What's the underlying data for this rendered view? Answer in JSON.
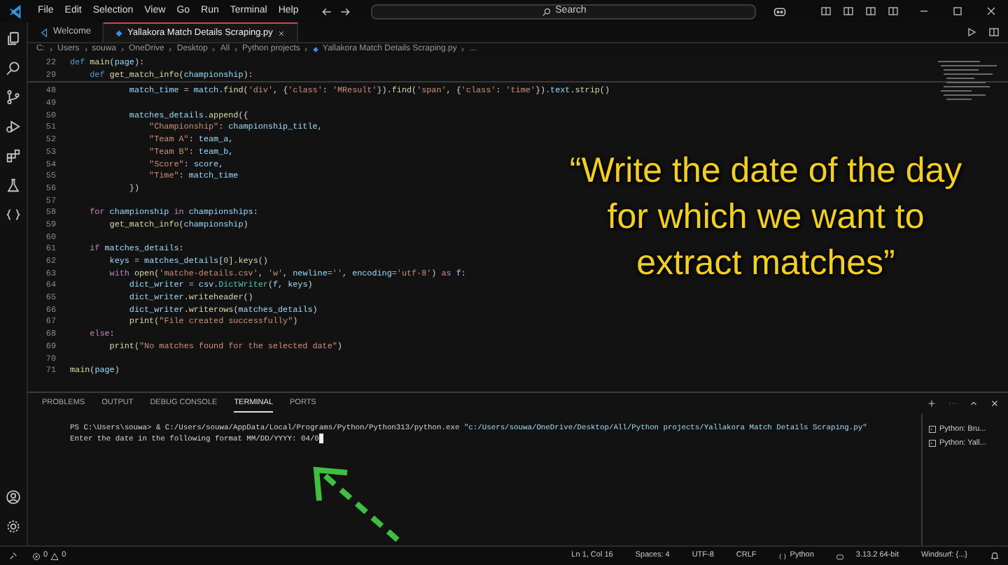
{
  "menu": [
    "File",
    "Edit",
    "Selection",
    "View",
    "Go",
    "Run",
    "Terminal",
    "Help"
  ],
  "search": {
    "placeholder": "Search"
  },
  "tabs": [
    {
      "label": "Welcome",
      "kind": "welcome",
      "selected": false
    },
    {
      "label": "Yallakora Match Details Scraping.py",
      "kind": "python",
      "selected": true
    }
  ],
  "breadcrumb": [
    "C:",
    "Users",
    "souwa",
    "OneDrive",
    "Desktop",
    "All",
    "Python projects",
    "Yallakora Match Details Scraping.py",
    "..."
  ],
  "sticky_lines": [
    {
      "number": "22",
      "tokens": [
        {
          "text": "def ",
          "kind": "kw"
        },
        {
          "text": "main",
          "kind": "fn"
        },
        {
          "text": "(",
          "kind": "p"
        },
        {
          "text": "page",
          "kind": "var"
        },
        {
          "text": "):",
          "kind": "p"
        }
      ]
    },
    {
      "number": "29",
      "tokens": [
        {
          "text": "    def ",
          "kind": "kw"
        },
        {
          "text": "get_match_info",
          "kind": "fn"
        },
        {
          "text": "(",
          "kind": "p"
        },
        {
          "text": "championship",
          "kind": "var"
        },
        {
          "text": "):",
          "kind": "p"
        }
      ]
    }
  ],
  "code_lines": [
    {
      "number": "48",
      "tokens": [
        {
          "text": "            match_time",
          "kind": "var"
        },
        {
          "text": " = ",
          "kind": "p"
        },
        {
          "text": "match",
          "kind": "var"
        },
        {
          "text": ".",
          "kind": "p"
        },
        {
          "text": "find",
          "kind": "fn"
        },
        {
          "text": "(",
          "kind": "p"
        },
        {
          "text": "'div'",
          "kind": "str"
        },
        {
          "text": ", {",
          "kind": "p"
        },
        {
          "text": "'class'",
          "kind": "str"
        },
        {
          "text": ": ",
          "kind": "p"
        },
        {
          "text": "'MResult'",
          "kind": "str"
        },
        {
          "text": "}).",
          "kind": "p"
        },
        {
          "text": "find",
          "kind": "fn"
        },
        {
          "text": "(",
          "kind": "p"
        },
        {
          "text": "'span'",
          "kind": "str"
        },
        {
          "text": ", {",
          "kind": "p"
        },
        {
          "text": "'class'",
          "kind": "str"
        },
        {
          "text": ": ",
          "kind": "p"
        },
        {
          "text": "'time'",
          "kind": "str"
        },
        {
          "text": "}).",
          "kind": "p"
        },
        {
          "text": "text",
          "kind": "var"
        },
        {
          "text": ".",
          "kind": "p"
        },
        {
          "text": "strip",
          "kind": "fn"
        },
        {
          "text": "()",
          "kind": "p"
        }
      ]
    },
    {
      "number": "49"
    },
    {
      "number": "50",
      "tokens": [
        {
          "text": "            matches_details",
          "kind": "var"
        },
        {
          "text": ".",
          "kind": "p"
        },
        {
          "text": "append",
          "kind": "fn"
        },
        {
          "text": "({",
          "kind": "p"
        }
      ]
    },
    {
      "number": "51",
      "tokens": [
        {
          "text": "                \"Championship\"",
          "kind": "str"
        },
        {
          "text": ": ",
          "kind": "p"
        },
        {
          "text": "championship_title",
          "kind": "var"
        },
        {
          "text": ",",
          "kind": "p"
        }
      ]
    },
    {
      "number": "52",
      "tokens": [
        {
          "text": "                \"Team A\"",
          "kind": "str"
        },
        {
          "text": ": ",
          "kind": "p"
        },
        {
          "text": "team_a",
          "kind": "var"
        },
        {
          "text": ",",
          "kind": "p"
        }
      ]
    },
    {
      "number": "53",
      "tokens": [
        {
          "text": "                \"Team B\"",
          "kind": "str"
        },
        {
          "text": ": ",
          "kind": "p"
        },
        {
          "text": "team_b",
          "kind": "var"
        },
        {
          "text": ",",
          "kind": "p"
        }
      ]
    },
    {
      "number": "54",
      "tokens": [
        {
          "text": "                \"Score\"",
          "kind": "str"
        },
        {
          "text": ": ",
          "kind": "p"
        },
        {
          "text": "score",
          "kind": "var"
        },
        {
          "text": ",",
          "kind": "p"
        }
      ]
    },
    {
      "number": "55",
      "tokens": [
        {
          "text": "                \"Time\"",
          "kind": "str"
        },
        {
          "text": ": ",
          "kind": "p"
        },
        {
          "text": "match_time",
          "kind": "var"
        }
      ]
    },
    {
      "number": "56",
      "tokens": [
        {
          "text": "            })",
          "kind": "p"
        }
      ]
    },
    {
      "number": "57"
    },
    {
      "number": "58",
      "tokens": [
        {
          "text": "    for ",
          "kind": "ctl"
        },
        {
          "text": "championship",
          "kind": "var"
        },
        {
          "text": " in ",
          "kind": "ctl"
        },
        {
          "text": "championships",
          "kind": "var"
        },
        {
          "text": ":",
          "kind": "p"
        }
      ]
    },
    {
      "number": "59",
      "tokens": [
        {
          "text": "        get_match_info",
          "kind": "fn"
        },
        {
          "text": "(",
          "kind": "p"
        },
        {
          "text": "championship",
          "kind": "var"
        },
        {
          "text": ")",
          "kind": "p"
        }
      ]
    },
    {
      "number": "60"
    },
    {
      "number": "61",
      "tokens": [
        {
          "text": "    if ",
          "kind": "ctl"
        },
        {
          "text": "matches_details",
          "kind": "var"
        },
        {
          "text": ":",
          "kind": "p"
        }
      ]
    },
    {
      "number": "62",
      "tokens": [
        {
          "text": "        keys",
          "kind": "var"
        },
        {
          "text": " = ",
          "kind": "p"
        },
        {
          "text": "matches_details",
          "kind": "var"
        },
        {
          "text": "[",
          "kind": "p"
        },
        {
          "text": "0",
          "kind": "num"
        },
        {
          "text": "].",
          "kind": "p"
        },
        {
          "text": "keys",
          "kind": "fn"
        },
        {
          "text": "()",
          "kind": "p"
        }
      ]
    },
    {
      "number": "63",
      "tokens": [
        {
          "text": "        with ",
          "kind": "ctl"
        },
        {
          "text": "open",
          "kind": "fn"
        },
        {
          "text": "(",
          "kind": "p"
        },
        {
          "text": "'matche-details.csv'",
          "kind": "str"
        },
        {
          "text": ", ",
          "kind": "p"
        },
        {
          "text": "'w'",
          "kind": "str"
        },
        {
          "text": ", ",
          "kind": "p"
        },
        {
          "text": "newline",
          "kind": "var"
        },
        {
          "text": "=",
          "kind": "p"
        },
        {
          "text": "''",
          "kind": "str"
        },
        {
          "text": ", ",
          "kind": "p"
        },
        {
          "text": "encoding",
          "kind": "var"
        },
        {
          "text": "=",
          "kind": "p"
        },
        {
          "text": "'utf-8'",
          "kind": "str"
        },
        {
          "text": ") ",
          "kind": "p"
        },
        {
          "text": "as ",
          "kind": "ctl"
        },
        {
          "text": "f",
          "kind": "var"
        },
        {
          "text": ":",
          "kind": "p"
        }
      ]
    },
    {
      "number": "64",
      "tokens": [
        {
          "text": "            dict_writer",
          "kind": "var"
        },
        {
          "text": " = ",
          "kind": "p"
        },
        {
          "text": "csv",
          "kind": "var"
        },
        {
          "text": ".",
          "kind": "p"
        },
        {
          "text": "DictWriter",
          "kind": "cls"
        },
        {
          "text": "(",
          "kind": "p"
        },
        {
          "text": "f",
          "kind": "var"
        },
        {
          "text": ", ",
          "kind": "p"
        },
        {
          "text": "keys",
          "kind": "var"
        },
        {
          "text": ")",
          "kind": "p"
        }
      ]
    },
    {
      "number": "65",
      "tokens": [
        {
          "text": "            dict_writer",
          "kind": "var"
        },
        {
          "text": ".",
          "kind": "p"
        },
        {
          "text": "writeheader",
          "kind": "fn"
        },
        {
          "text": "()",
          "kind": "p"
        }
      ]
    },
    {
      "number": "66",
      "tokens": [
        {
          "text": "            dict_writer",
          "kind": "var"
        },
        {
          "text": ".",
          "kind": "p"
        },
        {
          "text": "writerows",
          "kind": "fn"
        },
        {
          "text": "(",
          "kind": "p"
        },
        {
          "text": "matches_details",
          "kind": "var"
        },
        {
          "text": ")",
          "kind": "p"
        }
      ]
    },
    {
      "number": "67",
      "tokens": [
        {
          "text": "            print",
          "kind": "fn"
        },
        {
          "text": "(",
          "kind": "p"
        },
        {
          "text": "\"File created successfully\"",
          "kind": "str"
        },
        {
          "text": ")",
          "kind": "p"
        }
      ]
    },
    {
      "number": "68",
      "tokens": [
        {
          "text": "    else",
          "kind": "ctl"
        },
        {
          "text": ":",
          "kind": "p"
        }
      ]
    },
    {
      "number": "69",
      "tokens": [
        {
          "text": "        print",
          "kind": "fn"
        },
        {
          "text": "(",
          "kind": "p"
        },
        {
          "text": "\"No matches found for the selected date\"",
          "kind": "str"
        },
        {
          "text": ")",
          "kind": "p"
        }
      ]
    },
    {
      "number": "70"
    },
    {
      "number": "71",
      "tokens": [
        {
          "text": "main",
          "kind": "fn"
        },
        {
          "text": "(",
          "kind": "p"
        },
        {
          "text": "page",
          "kind": "var"
        },
        {
          "text": ")",
          "kind": "p"
        }
      ]
    }
  ],
  "annotation": {
    "lines": [
      "“Write the date of the day",
      "for which we want to",
      "extract matches”"
    ]
  },
  "panel_tabs": [
    {
      "label": "PROBLEMS",
      "selected": false
    },
    {
      "label": "OUTPUT",
      "selected": false
    },
    {
      "label": "DEBUG CONSOLE",
      "selected": false
    },
    {
      "label": "TERMINAL",
      "selected": true
    },
    {
      "label": "PORTS",
      "selected": false
    }
  ],
  "terminal": {
    "lines": [
      {
        "tokens": [
          {
            "text": "PS C:\\Users\\souwa> & C:/Users/souwa/AppData/Local/Programs/Python/Python313/python.exe ",
            "kind": "p"
          },
          {
            "text": "\"c:/Users/souwa/OneDrive/Desktop/All/Python projects/Yallakora Match Details Scraping.py\"",
            "kind": "str"
          }
        ]
      },
      {
        "tokens": [
          {
            "text": "Enter the date in the following format MM/DD/YYYY: 04/0",
            "kind": "p"
          }
        ],
        "cursor": true
      }
    ]
  },
  "terminal_list": [
    {
      "label": "Python: Bru..."
    },
    {
      "label": "Python: Yall..."
    }
  ],
  "status_bar": {
    "errors": "0",
    "warnings": "0",
    "right": [
      {
        "text": "Ln 1, Col 16"
      },
      {
        "text": "Spaces: 4"
      },
      {
        "text": "UTF-8"
      },
      {
        "text": "CRLF"
      },
      {
        "text": "Python",
        "kind": "language"
      },
      {
        "text": "3.13.2 64-bit",
        "kind": "interpreter"
      },
      {
        "text": "Windsurf: {...}"
      }
    ]
  }
}
